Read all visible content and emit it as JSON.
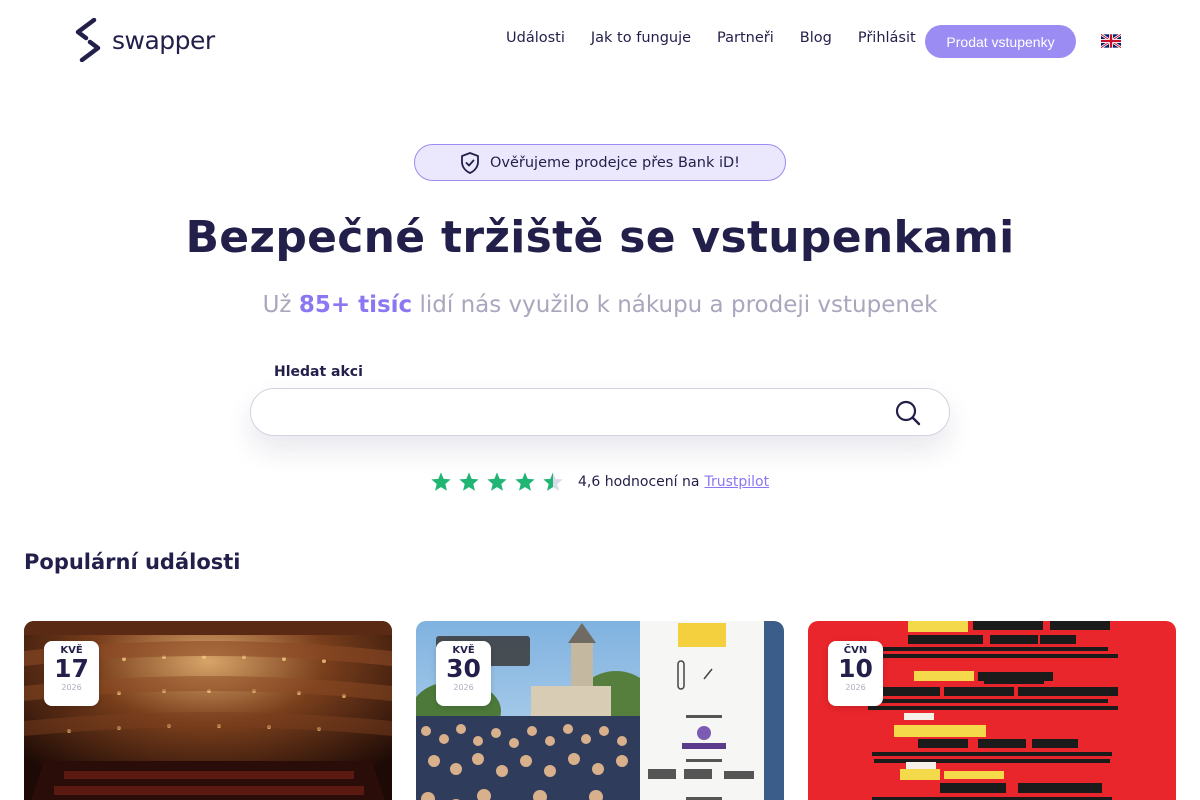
{
  "header": {
    "logo_text": "swapper",
    "nav": [
      {
        "label": "Události"
      },
      {
        "label": "Jak to funguje"
      },
      {
        "label": "Partneři"
      },
      {
        "label": "Blog"
      },
      {
        "label": "Přihlásit"
      }
    ],
    "sell_button": "Prodat vstupenky",
    "language_flag": "uk-flag-icon"
  },
  "hero": {
    "badge_text": "Ověřujeme prodejce přes Bank iD!",
    "badge_icon": "shield-check-icon",
    "title": "Bezpečné tržiště se vstupenkami",
    "subtitle_prefix": "Už",
    "subtitle_highlight": "85+ tisíc",
    "subtitle_suffix": "lidí nás využilo k nákupu a prodeji vstupenek"
  },
  "search": {
    "label": "Hledat akci",
    "value": "",
    "placeholder": "",
    "icon": "search-icon"
  },
  "rating": {
    "stars": 4.5,
    "text": "4,6 hodnocení na",
    "link": "Trustpilot",
    "star_color": "#21b573"
  },
  "popular": {
    "title": "Populární události",
    "events": [
      {
        "month": "KVĚ",
        "day": "17",
        "year": "2026"
      },
      {
        "month": "KVĚ",
        "day": "30",
        "year": "2026"
      },
      {
        "month": "ČVN",
        "day": "10",
        "year": "2026"
      }
    ]
  },
  "colors": {
    "brand_dark": "#221f4a",
    "accent": "#9a8cf3",
    "accent_text": "#8a77f2"
  }
}
